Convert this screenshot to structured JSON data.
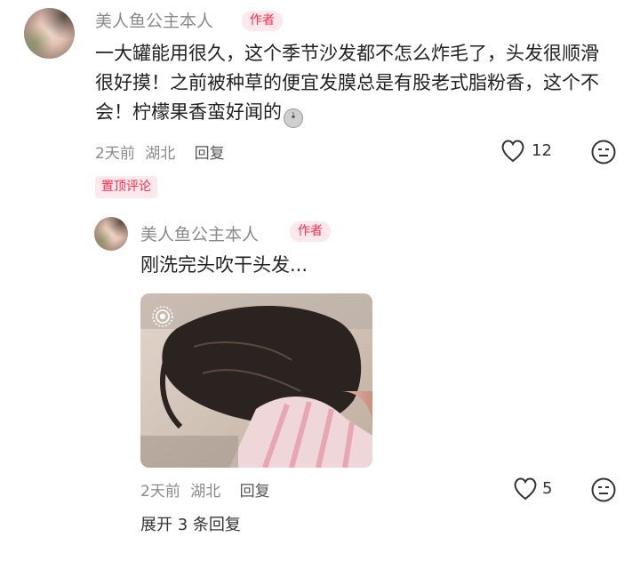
{
  "comment": {
    "author": "美人鱼公主本人",
    "author_badge": "作者",
    "text": "一大罐能用很久，这个季节沙发都不怎么炸毛了，头发很顺滑很好摸！之前被种草的便宜发膜总是有股老式脂粉香，这个不会！柠檬果香蛮好闻的",
    "time": "2天前",
    "location": "湖北",
    "reply_label": "回复",
    "like_count": "12",
    "pinned_label": "置顶评论"
  },
  "reply": {
    "author": "美人鱼公主本人",
    "author_badge": "作者",
    "text": "刚洗完头吹干头发...",
    "time": "2天前",
    "location": "湖北",
    "reply_label": "回复",
    "like_count": "5"
  },
  "expand_label": "展开 3 条回复",
  "colors": {
    "accent": "#ff2e4d",
    "badge_bg": "#fde8ec",
    "meta": "#8a8a8a"
  }
}
